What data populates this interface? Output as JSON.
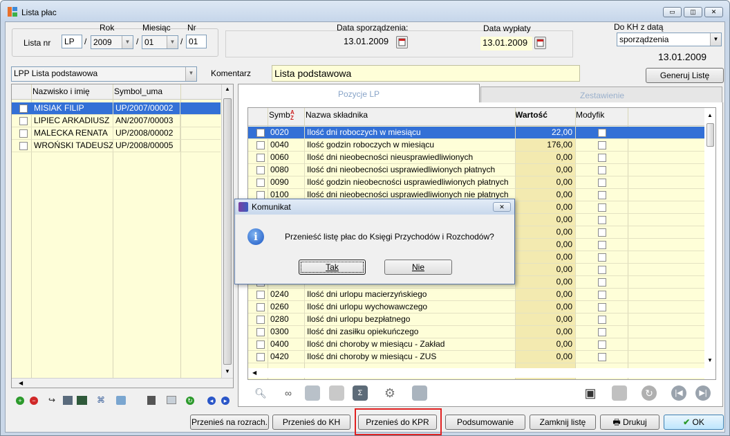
{
  "window": {
    "title": "Lista płac"
  },
  "header": {
    "lista_nr_label": "Lista nr",
    "rok_label": "Rok",
    "miesiac_label": "Miesiąc",
    "nr_label": "Nr",
    "prefix": "LP",
    "rok": "2009",
    "miesiac": "01",
    "nr": "01",
    "sep": "/",
    "data_sporz_label": "Data sporządzenia:",
    "data_sporz": "13.01.2009",
    "data_wypl_label": "Data wypłaty",
    "data_wypl": "13.01.2009",
    "do_kh_label": "Do KH z datą",
    "do_kh_value": "sporządzenia",
    "do_kh_date": "13.01.2009"
  },
  "list_type": "LPP Lista podstawowa",
  "komentarz_label": "Komentarz",
  "komentarz": "Lista podstawowa",
  "generuj_label": "Generuj Listę",
  "employees": {
    "col_name": "Nazwisko i imię",
    "col_symbol": "Symbol_uma",
    "rows": [
      {
        "name": "MISIAK FILIP",
        "symbol": "UP/2007/00002"
      },
      {
        "name": "LIPIEC ARKADIUSZ",
        "symbol": "AN/2007/00003"
      },
      {
        "name": "MALECKA RENATA",
        "symbol": "UP/2008/00002"
      },
      {
        "name": "WROŃSKI TADEUSZ",
        "symbol": "UP/2008/00005"
      }
    ]
  },
  "tabs": {
    "pozycje": "Pozycje LP",
    "zestawienie": "Zestawienie"
  },
  "items": {
    "col_symbol": "Symb",
    "col_name": "Nazwa składnika",
    "col_value": "Wartość",
    "col_mod": "Modyfik",
    "rows": [
      {
        "s": "0020",
        "n": "Ilość dni roboczych w miesiącu",
        "v": "22,00"
      },
      {
        "s": "0040",
        "n": "Ilość godzin roboczych w miesiącu",
        "v": "176,00"
      },
      {
        "s": "0060",
        "n": "Ilość dni nieobecności nieusprawiedliwionych",
        "v": "0,00"
      },
      {
        "s": "0080",
        "n": "Ilość dni nieobecności usprawiedliwionych płatnych",
        "v": "0,00"
      },
      {
        "s": "0090",
        "n": "Ilość godzin nieobecności usprawiedliwionych płatnych",
        "v": "0,00"
      },
      {
        "s": "0100",
        "n": "Ilość dni nieobecności usprawiedliwionych nie płatnych",
        "v": "0,00"
      },
      {
        "s": "",
        "n": "",
        "v": "0,00"
      },
      {
        "s": "",
        "n": "",
        "v": "0,00"
      },
      {
        "s": "",
        "n": "",
        "v": "0,00"
      },
      {
        "s": "",
        "n": "",
        "v": "0,00"
      },
      {
        "s": "",
        "n": "",
        "v": "0,00"
      },
      {
        "s": "",
        "n": "",
        "v": "0,00"
      },
      {
        "s": "",
        "n": "",
        "v": "0,00"
      },
      {
        "s": "0240",
        "n": "Ilość dni urlopu macierzyńskiego",
        "v": "0,00"
      },
      {
        "s": "0260",
        "n": "Ilość dni urlopu wychowawczego",
        "v": "0,00"
      },
      {
        "s": "0280",
        "n": "Ilość dni urlopu bezpłatnego",
        "v": "0,00"
      },
      {
        "s": "0300",
        "n": "Ilość dni zasiłku opiekuńczego",
        "v": "0,00"
      },
      {
        "s": "0400",
        "n": "Ilość dni choroby w miesiącu - Zakład",
        "v": "0,00"
      },
      {
        "s": "0420",
        "n": "Ilość dni choroby w miesiącu - ZUS",
        "v": "0,00"
      }
    ]
  },
  "dialog": {
    "title": "Komunikat",
    "message": "Przenieść listę płac do Księgi Przychodów i Rozchodów?",
    "yes": "Tak",
    "no": "Nie"
  },
  "buttons": {
    "rozrach": "Przenieś na rozrach.",
    "kh": "Przenieś do KH",
    "kpr": "Przenieś do KPR",
    "podsum": "Podsumowanie",
    "zamknij": "Zamknij listę",
    "drukuj": "Drukuj",
    "ok": "OK"
  },
  "colors": {
    "selection": "#3370d6",
    "grid_bg": "#fefed8",
    "value_col": "#f3eab0",
    "highlight_border": "#e02020"
  }
}
